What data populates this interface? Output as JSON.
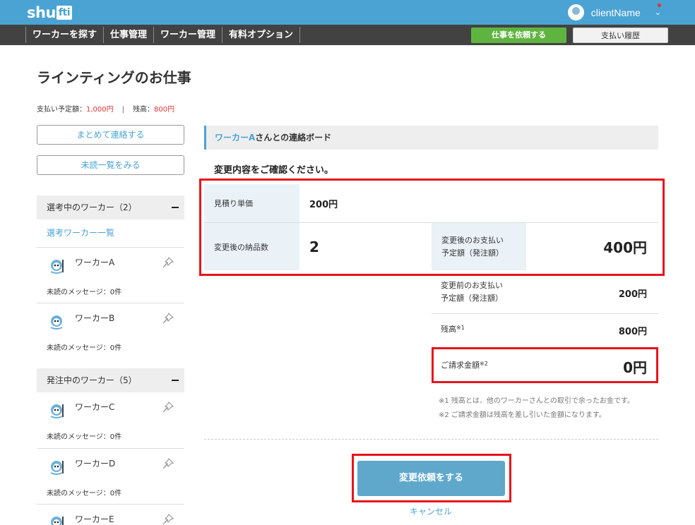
{
  "header": {
    "logo_left": "shu",
    "logo_mid": "fti",
    "user_name": "clientName",
    "nav": [
      "ワーカーを探す",
      "仕事管理",
      "ワーカー管理",
      "有料オプション"
    ],
    "order_button": "仕事を依頼する",
    "history_button": "支払い履歴"
  },
  "page": {
    "title": "ラインティングのお仕事",
    "budget_label": "支払い予定額：",
    "budget_value": "1,000円",
    "separator": "|",
    "balance_label": "残高：",
    "balance_value": "800円"
  },
  "sidebar": {
    "contact_all": "まとめて連絡する",
    "unread_list": "未読一覧をみる",
    "groups": [
      {
        "title": "選考中のワーカー（2）",
        "link": "選考ワーカー一覧",
        "workers": [
          {
            "name": "ワーカーA",
            "unread": "未読のメッセージ：0件"
          },
          {
            "name": "ワーカーB",
            "unread": "未読のメッセージ：0件"
          }
        ]
      },
      {
        "title": "発注中のワーカー（5）",
        "workers": [
          {
            "name": "ワーカーC",
            "unread": "未読のメッセージ：0件"
          },
          {
            "name": "ワーカーD",
            "unread": "未読のメッセージ：0件"
          },
          {
            "name": "ワーカーE",
            "unread": ""
          }
        ]
      }
    ]
  },
  "board": {
    "worker_name": "ワーカーA",
    "title_suffix": "さんとの連絡ボード",
    "confirm_title": "変更内容をご確認ください。",
    "unit_price_label": "見積り単価",
    "unit_price": "200円",
    "quantity_label": "変更後の納品数",
    "quantity": "2",
    "after_amount_label_1": "変更後のお支払い",
    "after_amount_label_2": "予定額（発注額）",
    "after_amount": "400円",
    "before_amount_label_1": "変更前のお支払い",
    "before_amount_label_2": "予定額（発注額）",
    "before_amount": "200円",
    "balance_label": "残高",
    "balance_note": "※1",
    "balance": "800円",
    "billing_label": "ご請求金額",
    "billing_note": "※2",
    "billing": "0円",
    "note1": "※1 残高とは、他のワーカーさんとの取引で余ったお金です。",
    "note2": "※2 ご請求金額は残高を差し引いた金額になります。",
    "submit": "変更依頼をする",
    "cancel": "キャンセル"
  },
  "colors": {
    "brand": "#4aa3d3",
    "nav_bg": "#424242",
    "order_green": "#5fb440",
    "highlight_red": "#e8141b",
    "amount_red": "#e53232"
  }
}
